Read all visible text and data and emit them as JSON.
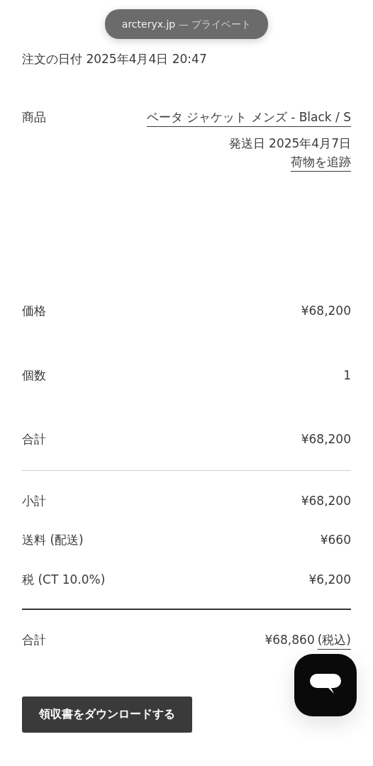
{
  "browser_bar": {
    "domain": "arcteryx.jp",
    "mode": "— プライベート"
  },
  "order_date": {
    "label": "注文の日付",
    "value": "2025年4月4日 20:47"
  },
  "item": {
    "label": "商品",
    "name": "ベータ ジャケット メンズ - Black / S",
    "ship_date": "発送日 2025年4月7日",
    "track_link": "荷物を追跡"
  },
  "item_rows": [
    {
      "label": "価格",
      "value": "¥68,200"
    },
    {
      "label": "個数",
      "value": "1"
    },
    {
      "label": "合計",
      "value": "¥68,200"
    }
  ],
  "summary_rows": [
    {
      "label": "小計",
      "value": "¥68,200"
    },
    {
      "label": "送料 (配送)",
      "value": "¥660"
    },
    {
      "label": "税 (CT 10.0%)",
      "value": "¥6,200"
    }
  ],
  "grand_total": {
    "label": "合計",
    "value": "¥68,860",
    "note": "(税込)"
  },
  "download_button": "領収書をダウンロードする"
}
